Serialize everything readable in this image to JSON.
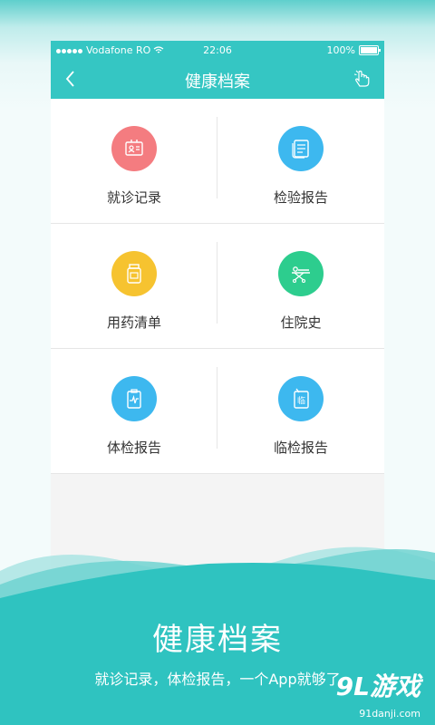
{
  "status_bar": {
    "carrier": "Vodafone RO",
    "time": "22:06",
    "battery": "100%"
  },
  "nav": {
    "title": "健康档案",
    "back_icon": "chevron-left-icon",
    "right_icon": "hand-touch-icon"
  },
  "grid": [
    {
      "label": "就诊记录",
      "color": "#f47c80",
      "icon": "id-card-icon"
    },
    {
      "label": "检验报告",
      "color": "#3db8ef",
      "icon": "report-list-icon"
    },
    {
      "label": "用药清单",
      "color": "#f6c330",
      "icon": "medicine-bottle-icon"
    },
    {
      "label": "住院史",
      "color": "#2dcd8e",
      "icon": "hospital-bed-icon"
    },
    {
      "label": "体检报告",
      "color": "#3db8ef",
      "icon": "health-chart-icon"
    },
    {
      "label": "临检报告",
      "color": "#3db8ef",
      "icon": "clinical-report-icon"
    }
  ],
  "promo": {
    "title": "健康档案",
    "subtitle": "就诊记录，体检报告，一个App就够了"
  },
  "watermark": {
    "logo": "9L游戏",
    "site": "91danji.com"
  },
  "colors": {
    "accent": "#35c6c3",
    "wave_dark": "#2fc3c0"
  }
}
